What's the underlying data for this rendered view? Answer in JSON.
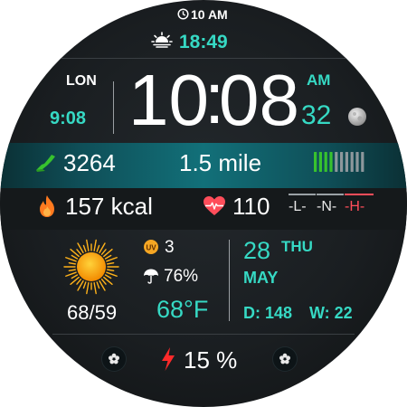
{
  "status": {
    "time": "10 AM"
  },
  "sunrise": {
    "time": "18:49"
  },
  "clock": {
    "city": "LON",
    "local_time": "9:08",
    "hours": "10",
    "colon": ":",
    "minutes": "08",
    "ampm": "AM",
    "seconds": "32"
  },
  "activity": {
    "steps": "3264",
    "distance": "1.5 mile",
    "bar_levels_lit": 4,
    "bar_levels_total": 10
  },
  "health": {
    "kcal": "157 kcal",
    "heart_rate": "110",
    "zones": [
      "-L-",
      "-N-",
      "-H-"
    ]
  },
  "weather": {
    "uv": "3",
    "rain": "76%",
    "hi_lo": "68/59",
    "temp": "68°F"
  },
  "date": {
    "day": "28",
    "weekday": "THU",
    "month": "MAY",
    "day_of_year": "D: 148",
    "week": "W: 22"
  },
  "battery": {
    "level": "15 %"
  },
  "colors": {
    "accent": "#36d9c4",
    "step_green": "#37c22e",
    "flame_orange": "#ff7a1f",
    "heart_red": "#ff4d5a",
    "bolt_red": "#ff2a2a",
    "sun_yellow": "#ffae1a"
  },
  "icons": [
    "clock-icon",
    "sunrise-icon",
    "moon-icon",
    "shoe-icon",
    "level-bars",
    "flame-icon",
    "heart-rate-icon",
    "sun-icon",
    "uv-icon",
    "umbrella-icon",
    "fan-icon",
    "bolt-icon"
  ]
}
